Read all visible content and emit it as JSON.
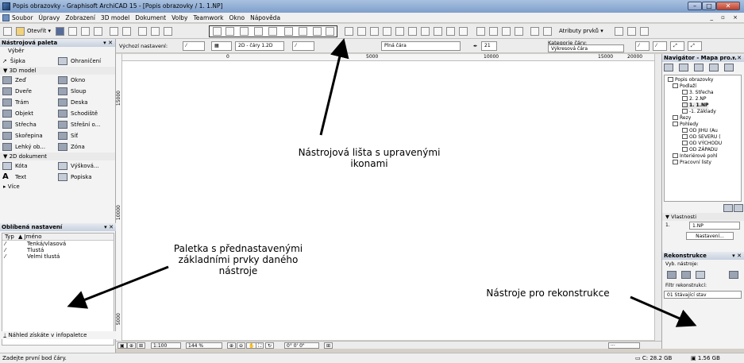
{
  "window": {
    "title": "Popis obrazovky - Graphisoft ArchiCAD 15 - [Popis obrazovky / 1. 1.NP]",
    "min_glyph": "–",
    "max_glyph": "□",
    "close_glyph": "✕"
  },
  "menu": {
    "items": [
      "Soubor",
      "Úpravy",
      "Zobrazení",
      "3D model",
      "Dokument",
      "Volby",
      "Teamwork",
      "Okno",
      "Nápověda"
    ],
    "mdi_controls": "_ ▫ ×"
  },
  "toolbar": {
    "open_label": "Otevřít ▾",
    "atributy_label": "Atributy prvků ▾"
  },
  "left_palette": {
    "title": "Nástrojová paleta",
    "title_controls": "▾ ✕",
    "vyber_label": "Výběr",
    "sipka_label": "Šipka",
    "ohraniceni_label": "Ohraničení",
    "section_3d": "▼ 3D model",
    "tools_3d": [
      {
        "icon": "wall-icon",
        "label": "Zeď"
      },
      {
        "icon": "window-icon",
        "label": "Okno"
      },
      {
        "icon": "door-icon",
        "label": "Dveře"
      },
      {
        "icon": "column-icon",
        "label": "Sloup"
      },
      {
        "icon": "beam-icon",
        "label": "Trám"
      },
      {
        "icon": "slab-icon",
        "label": "Deska"
      },
      {
        "icon": "object-icon",
        "label": "Objekt"
      },
      {
        "icon": "stair-icon",
        "label": "Schodiště"
      },
      {
        "icon": "roof-icon",
        "label": "Střecha"
      },
      {
        "icon": "roof-window-icon",
        "label": "Střešní o..."
      },
      {
        "icon": "shell-icon",
        "label": "Skořepina"
      },
      {
        "icon": "mesh-icon",
        "label": "Síť"
      },
      {
        "icon": "curtain-wall-icon",
        "label": "Lehký ob..."
      },
      {
        "icon": "zone-icon",
        "label": "Zóna"
      }
    ],
    "section_2d": "▼ 2D dokument",
    "tools_2d": [
      {
        "icon": "dimension-icon",
        "label": "Kóta"
      },
      {
        "icon": "level-dimension-icon",
        "label": "Výšková..."
      },
      {
        "icon": "text-icon",
        "label": "Text"
      },
      {
        "icon": "label-icon",
        "label": "Popiska"
      }
    ],
    "more_label": "▸ Více"
  },
  "favorites": {
    "title": "Oblíbená nastavení",
    "title_controls": "▾ ✕",
    "col_type": "Typ",
    "col_name": "▲ Jméno",
    "rows": [
      "Tenká/vlasová",
      "Tlustá",
      "Velmi tlustá"
    ],
    "footer": "Náhled získáte v infopaletce"
  },
  "infobox": {
    "default_settings_label": "Výchozí nastavení:",
    "lines_label": "2D - čáry 1.2D",
    "line_type": "Plná čára",
    "pen_number": "21",
    "category_label": "Kategorie čáry:",
    "category_value": "Výkresová čára"
  },
  "rulers": {
    "h_labels": [
      "0",
      "5000",
      "10000",
      "15000",
      "20000"
    ],
    "v_labels": [
      "15000",
      "10000",
      "5000"
    ]
  },
  "scrollbar": {
    "scale": "1:100",
    "zoom": "144 %",
    "angle": "0° 0' 0\""
  },
  "navigator": {
    "title": "Navigátor - Mapa pro...",
    "title_controls": "▾ ✕",
    "tree": [
      {
        "label": "Popis obrazovky",
        "level": 0
      },
      {
        "label": "Podlaží",
        "level": 1
      },
      {
        "label": "3. Střecha",
        "level": 2
      },
      {
        "label": "2. 2.NP",
        "level": 2
      },
      {
        "label": "1. 1.NP",
        "level": 2
      },
      {
        "label": "-1. Základy",
        "level": 2
      },
      {
        "label": "Řezy",
        "level": 1
      },
      {
        "label": "Pohledy",
        "level": 1
      },
      {
        "label": "OD JIHU (Au",
        "level": 2
      },
      {
        "label": "OD SEVERU (",
        "level": 2
      },
      {
        "label": "OD VÝCHODU",
        "level": 2
      },
      {
        "label": "OD ZÁPADU",
        "level": 2
      },
      {
        "label": "Interiérové pohl",
        "level": 1
      },
      {
        "label": "Pracovní listy",
        "level": 1
      }
    ],
    "properties_label": "▼ Vlastnosti",
    "prop_num": "1.",
    "prop_value": "1.NP",
    "settings_button": "Nastavení..."
  },
  "renovation": {
    "title": "Rekonstrukce",
    "title_controls": "▾ ✕",
    "show_label": "Vyb. nástroje:",
    "filter_label": "Filtr rekonstrukcí:",
    "filter_value": "01 Stávající stav"
  },
  "status": {
    "message": "Zadejte první bod čáry.",
    "disk": "C: 28.2 GB",
    "memory": "1.56 GB"
  },
  "annotations": {
    "toolbar_note_1": "Nástrojová lišta s upravenými",
    "toolbar_note_2": "ikonami",
    "palette_note_1": "Paletka s přednastavenými",
    "palette_note_2": "základními prvky daného",
    "palette_note_3": "nástroje",
    "renovation_note": "Nástroje pro rekonstrukce"
  }
}
